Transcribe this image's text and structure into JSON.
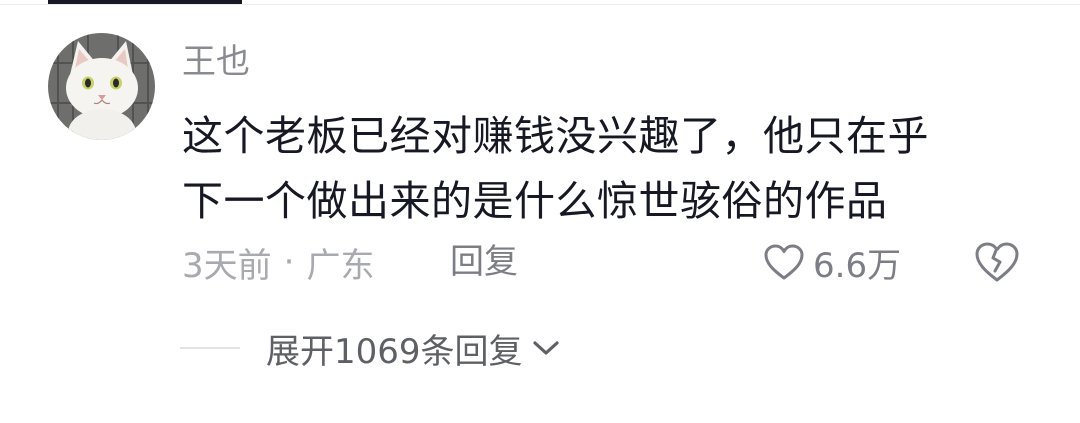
{
  "comment": {
    "username": "王也",
    "text_lines": [
      "这个老板已经对赚钱没兴趣了，他只在乎",
      "下一个做出来的是什么惊世骇俗的作品"
    ],
    "time": "3天前",
    "separator": "·",
    "location": "广东",
    "reply_label": "回复",
    "like_count": "6.6万",
    "expand_replies_label": "展开1069条回复"
  },
  "icons": {
    "avatar": "white-cat-avatar",
    "like": "heart-outline-icon",
    "dislike": "broken-heart-icon",
    "expand": "chevron-down-icon"
  },
  "colors": {
    "primary_text": "#161823",
    "secondary_text": "#8a8b91",
    "meta_text": "#a9aab0",
    "action_text": "#7d7e85"
  }
}
